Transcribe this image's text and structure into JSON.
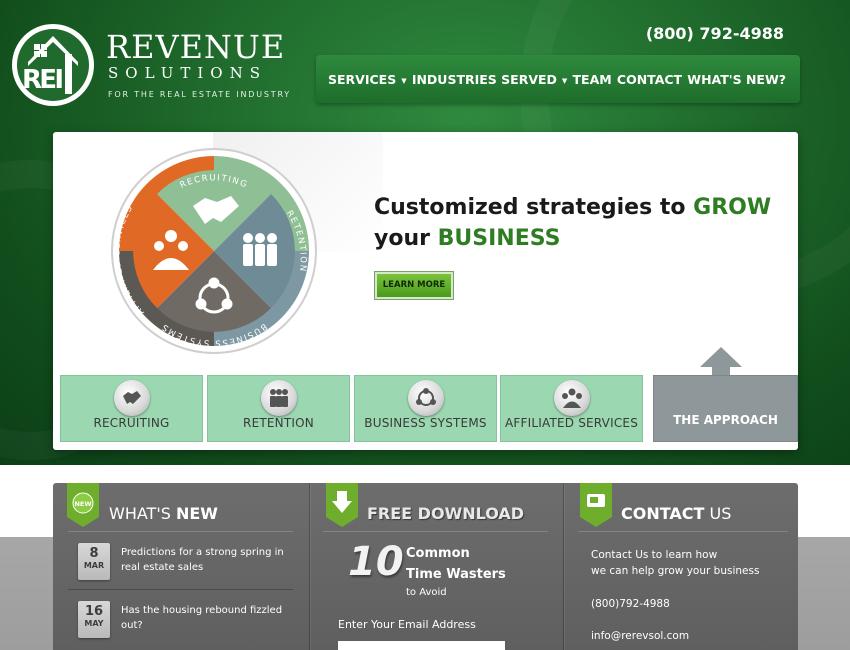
{
  "header": {
    "phone": "(800) 792-4988",
    "logo": {
      "monogram": "REI",
      "word": "REVENUE",
      "sub": "SOLUTIONS",
      "tagline": "FOR THE REAL ESTATE INDUSTRY"
    },
    "nav": [
      {
        "label": "SERVICES",
        "has_dropdown": true
      },
      {
        "label": "INDUSTRIES SERVED",
        "has_dropdown": true
      },
      {
        "label": "TEAM",
        "has_dropdown": false
      },
      {
        "label": "CONTACT",
        "has_dropdown": false
      },
      {
        "label": "WHAT'S NEW?",
        "has_dropdown": false
      }
    ],
    "caret": "▼"
  },
  "hero": {
    "headline_part1": "Customized strategies to ",
    "headline_grow": "GROW",
    "headline_part2": "your ",
    "headline_business": "BUSINESS",
    "learn_more": "LEARN MORE",
    "wheel": {
      "recruiting": "RECRUITING",
      "retention": "RETENTION",
      "business_systems": "BUSINESS SYSTEMS",
      "affiliated_services": "AFFILIATED SERVICES"
    },
    "tiles": [
      {
        "label": "RECRUITING",
        "icon": "handshake-icon"
      },
      {
        "label": "RETENTION",
        "icon": "people-icon"
      },
      {
        "label": "BUSINESS SYSTEMS",
        "icon": "network-icon"
      },
      {
        "label": "AFFILIATED SERVICES",
        "icon": "team-icon"
      }
    ],
    "approach": "THE APPROACH"
  },
  "whats_new": {
    "title_light": "WHAT'S ",
    "title_bold": "NEW",
    "badge": "NEW",
    "items": [
      {
        "day": "8",
        "month": "MAR",
        "text": "Predictions for a strong spring in real estate sales"
      },
      {
        "day": "16",
        "month": "MAY",
        "text": "Has the housing rebound fizzled out?"
      }
    ]
  },
  "download": {
    "title": "FREE DOWNLOAD",
    "number": "10",
    "line1": "Common",
    "line2": "Time Wasters",
    "line3": "to Avoid",
    "email_label": "Enter Your Email Address",
    "email_value": ""
  },
  "contact": {
    "title_bold": "CONTACT",
    "title_light": " US",
    "line1": "Contact Us to learn how",
    "line2": "we can help grow your business",
    "phone": "(800)792-4988",
    "email": "info@rerevsol.com"
  },
  "colors": {
    "brand_green": "#1f6a2c",
    "accent_green": "#2e7d22",
    "tile_green": "#9bd7b0",
    "wheel_green": "#8fbf95",
    "wheel_blue": "#6e8b96",
    "wheel_orange": "#e06a25",
    "wheel_gray": "#6f6a63"
  }
}
